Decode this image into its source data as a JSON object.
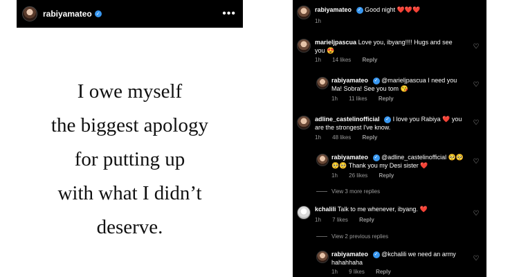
{
  "post": {
    "username": "rabiyamateo",
    "verified_icon": "verified-badge-icon",
    "more_icon": "more-dots-icon",
    "more_glyph": "•••",
    "quote_lines": [
      "I owe myself",
      "the biggest apology",
      "for putting up",
      "with what I didn’t",
      "deserve."
    ]
  },
  "comments": {
    "caption": {
      "username": "rabiyamateo",
      "text": "Good night",
      "hearts": "❤️❤️❤️",
      "time": "1h"
    },
    "items": [
      {
        "username": "marieljpascua",
        "text": "Love you, ibyang!!!! Hugs and see you",
        "emoji": "😍",
        "time": "1h",
        "likes": "14 likes",
        "reply": "Reply"
      },
      {
        "username": "rabiyamateo",
        "text": "@marieljpascua I need you Ma! Sobra! See you tom",
        "emoji": "😘",
        "time": "1h",
        "likes": "11 likes",
        "reply": "Reply"
      },
      {
        "username": "adline_castelinofficial",
        "text": "I love you Rabiya",
        "text2": "you are the strongest I've know.",
        "heart": "❤️",
        "time": "1h",
        "likes": "48 likes",
        "reply": "Reply"
      },
      {
        "username": "rabiyamateo",
        "text": "@adline_castelinofficial",
        "emoji": "🥺🥺🥺🥺",
        "text2": "Thank you my Desi sister",
        "heart": "❤️",
        "time": "1h",
        "likes": "26 likes",
        "reply": "Reply"
      },
      {
        "view_more": "View 3 more replies"
      },
      {
        "username": "kchalili",
        "text": "Talk to me whenever, ibyang.",
        "heart": "❤️",
        "time": "1h",
        "likes": "7 likes",
        "reply": "Reply"
      },
      {
        "view_prev": "View 2 previous replies"
      },
      {
        "username": "rabiyamateo",
        "text": "@kchalili we need an army hahahhaha",
        "time": "1h",
        "likes": "9 likes",
        "reply": "Reply"
      }
    ],
    "like_icon": "heart-outline-icon",
    "like_glyph": "♡"
  }
}
